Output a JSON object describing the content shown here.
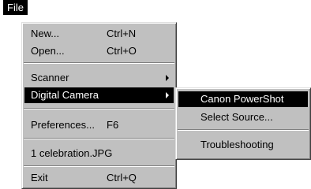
{
  "menubar": {
    "file_label": "File"
  },
  "file_menu": {
    "items": [
      {
        "label": "New...",
        "accel": "Ctrl+N"
      },
      {
        "label": "Open...",
        "accel": "Ctrl+O"
      },
      {
        "label": "Scanner"
      },
      {
        "label": "Digital Camera"
      },
      {
        "label": "Preferences...",
        "accel": "F6"
      },
      {
        "label": "1 celebration.JPG"
      },
      {
        "label": "Exit",
        "accel": "Ctrl+Q"
      }
    ]
  },
  "camera_submenu": {
    "items": [
      {
        "label": "Canon PowerShot"
      },
      {
        "label": "Select Source..."
      },
      {
        "label": "Troubleshooting"
      }
    ]
  }
}
